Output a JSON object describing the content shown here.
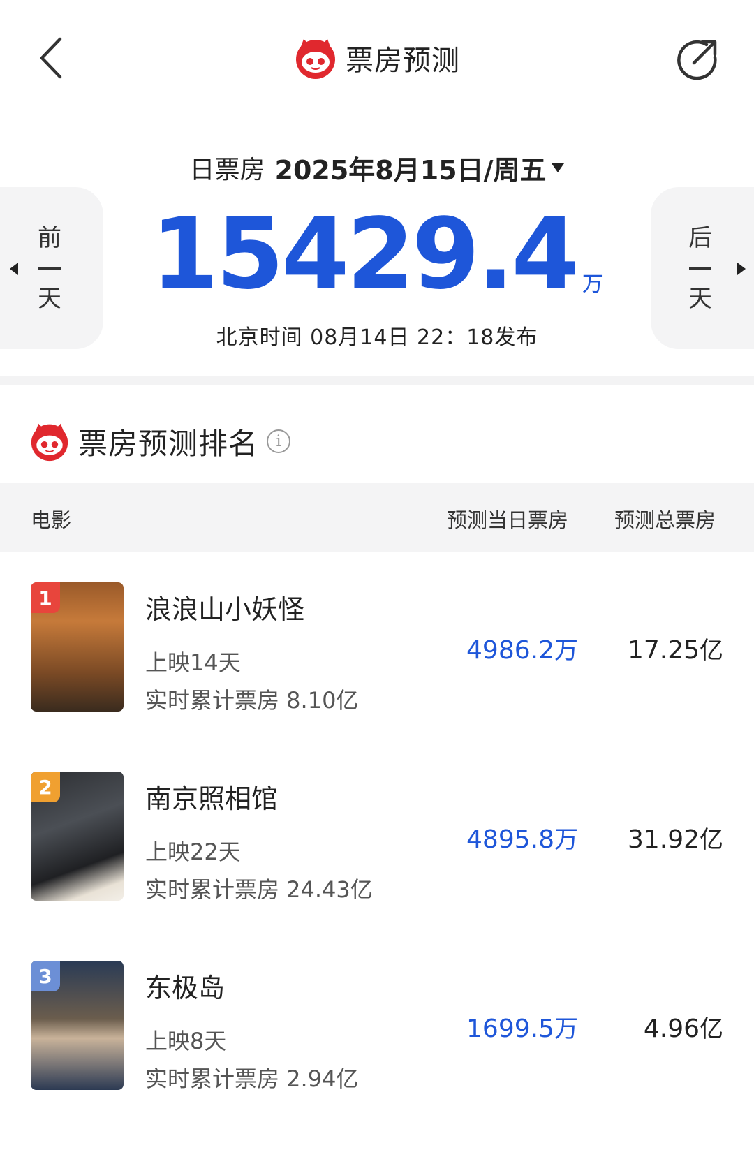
{
  "header": {
    "title": "票房预测",
    "back_icon": "chevron-left-icon",
    "share_icon": "share-icon"
  },
  "date_selector": {
    "label": "日票房",
    "date": "2025年8月15日/周五"
  },
  "nav": {
    "prev": [
      "前",
      "天"
    ],
    "next": [
      "后",
      "天"
    ]
  },
  "total": {
    "value": "15429.4",
    "unit": "万",
    "publish_time": "北京时间  08月14日  22：18发布"
  },
  "ranking": {
    "title": "票房预测排名",
    "columns": {
      "movie": "电影",
      "day": "预测当日票房",
      "total": "预测总票房"
    },
    "rows": [
      {
        "rank": "1",
        "name": "浪浪山小妖怪",
        "days": "上映14天",
        "cumulative": "实时累计票房 8.10亿",
        "day_value": "4986.2",
        "day_unit": "万",
        "total_value": "17.25",
        "total_unit": "亿",
        "badge_color": "#e8453c"
      },
      {
        "rank": "2",
        "name": "南京照相馆",
        "days": "上映22天",
        "cumulative": "实时累计票房 24.43亿",
        "day_value": "4895.8",
        "day_unit": "万",
        "total_value": "31.92",
        "total_unit": "亿",
        "badge_color": "#f0a030"
      },
      {
        "rank": "3",
        "name": "东极岛",
        "days": "上映8天",
        "cumulative": "实时累计票房 2.94亿",
        "day_value": "1699.5",
        "day_unit": "万",
        "total_value": "4.96",
        "total_unit": "亿",
        "badge_color": "#6c8fd6"
      }
    ]
  },
  "colors": {
    "accent": "#1e56d9",
    "brand": "#e0282e"
  }
}
